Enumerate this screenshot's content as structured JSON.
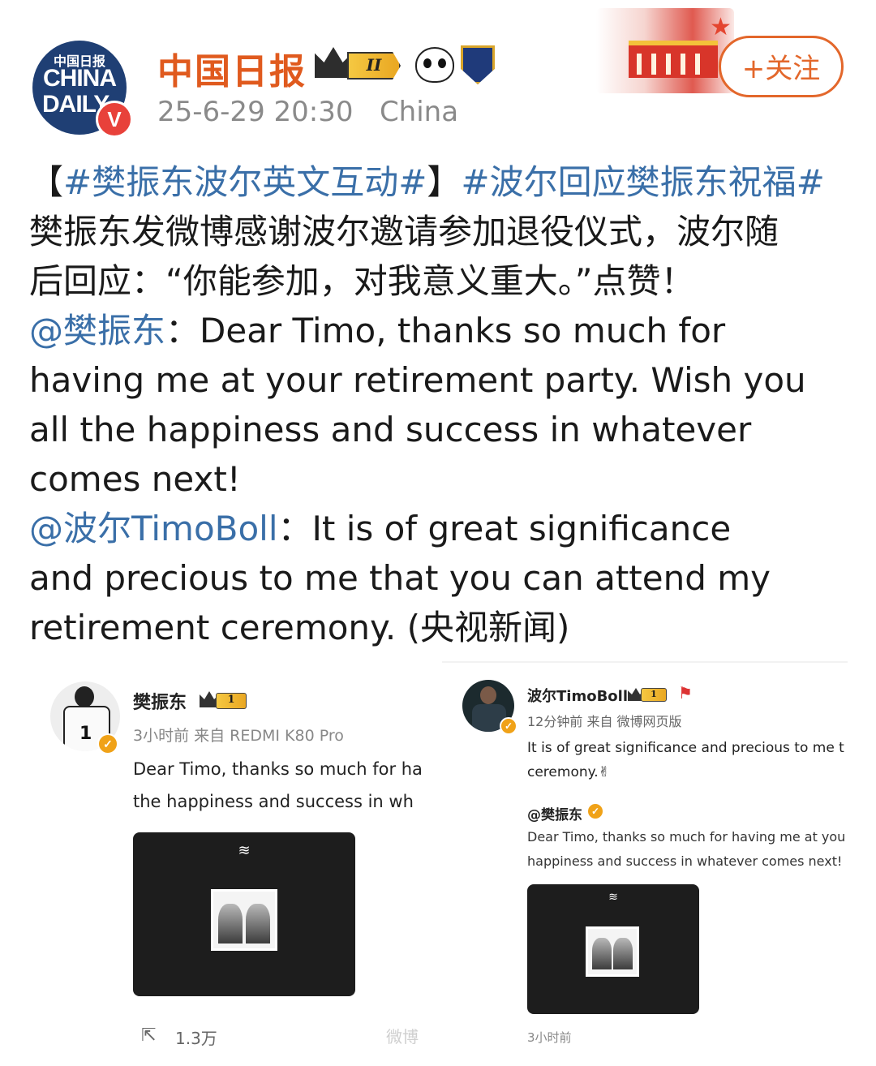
{
  "post": {
    "author": "中国日报",
    "avatar_cn": "中国日报",
    "avatar_l1": "CHINA",
    "avatar_l2": "DAILY",
    "level_badge": "II",
    "verified_mark": "V",
    "timestamp": "25-6-29 20:30",
    "location": "China",
    "follow_label": "+关注",
    "hashtag1": "#樊振东波尔英文互动#",
    "hashtag2": "#波尔回应樊振东祝福#",
    "bracket_open": "【",
    "bracket_close": "】",
    "line2": "樊振东发微博感谢波尔邀请参加退役仪式，波尔随",
    "line3": "后回应：“你能参加，对我意义重大。”点赞！",
    "mention1": "@樊振东",
    "quote1_l1": "：Dear Timo, thanks so much for",
    "quote1_l2": "having me at your retirement party. Wish you",
    "quote1_l3": "all the happiness and success in whatever",
    "quote1_l4": "comes next!",
    "mention2": "@波尔TimoBoll",
    "quote2_l1": "：It is of great significance",
    "quote2_l2": "and precious to me that you can attend my",
    "quote2_l3": "retirement ceremony. (央视新闻)"
  },
  "embed_left": {
    "name": "樊振东",
    "level": "1",
    "meta": "3小时前  来自 REDMI K80 Pro",
    "text1": "Dear Timo, thanks so much for ha",
    "text2": "the happiness and success in wh",
    "jersey_number": "1",
    "repost_count": "1.3万"
  },
  "embed_right": {
    "name": "波尔TimoBoll",
    "level": "1",
    "meta": "12分钟前  来自 微博网页版",
    "text1": "It is of great significance and precious to me t",
    "text2": "ceremony.✌",
    "quoted_name": "@樊振东",
    "quoted_text1": "Dear Timo, thanks so much for having me at you",
    "quoted_text2": "happiness and success in whatever comes next!",
    "time": "3小时前"
  },
  "watermark": "微博"
}
